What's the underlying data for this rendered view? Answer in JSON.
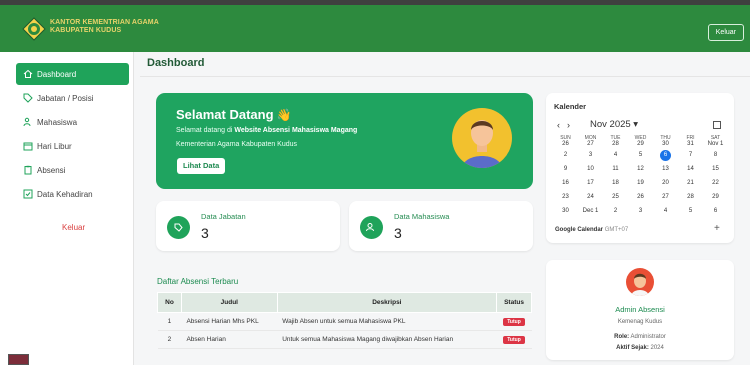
{
  "brand": {
    "line1": "KANTOR KEMENTRIAN AGAMA",
    "line2": "KABUPATEN KUDUS"
  },
  "topbar": {
    "logout_label": "Keluar"
  },
  "sidebar": {
    "items": [
      {
        "label": "Dashboard",
        "icon": "home-icon",
        "active": true
      },
      {
        "label": "Jabatan / Posisi",
        "icon": "tag-icon"
      },
      {
        "label": "Mahasiswa",
        "icon": "users-icon"
      },
      {
        "label": "Hari Libur",
        "icon": "calendar-icon"
      },
      {
        "label": "Absensi",
        "icon": "clipboard-icon"
      },
      {
        "label": "Data Kehadiran",
        "icon": "checkbox-icon"
      }
    ],
    "logout_label": "Keluar"
  },
  "page": {
    "title": "Dashboard"
  },
  "welcome": {
    "title": "Selamat Datang",
    "wave": "👋",
    "text_prefix": "Selamat datang di ",
    "text_bold": "Website Absensi Mahasiswa Magang",
    "text2": "Kementerian Agama Kabupaten Kudus",
    "button_label": "Lihat Data"
  },
  "stats": [
    {
      "label": "Data Jabatan",
      "value": "3",
      "icon": "tag-icon"
    },
    {
      "label": "Data Mahasiswa",
      "value": "3",
      "icon": "users-icon"
    }
  ],
  "calendar": {
    "title": "Kalender",
    "month": "Nov 2025",
    "footer_brand": "Google Calendar",
    "footer_tz": "GMT+07",
    "days": [
      "SUN",
      "MON",
      "TUE",
      "WED",
      "THU",
      "FRI",
      "SAT"
    ],
    "header_dates": [
      "26",
      "27",
      "28",
      "29",
      "30",
      "31",
      "Nov 1"
    ],
    "weeks": [
      [
        "2",
        "3",
        "4",
        "5",
        "6",
        "7",
        "8"
      ],
      [
        "9",
        "10",
        "11",
        "12",
        "13",
        "14",
        "15"
      ],
      [
        "16",
        "17",
        "18",
        "19",
        "20",
        "21",
        "22"
      ],
      [
        "23",
        "24",
        "25",
        "26",
        "27",
        "28",
        "29"
      ],
      [
        "30",
        "Dec 1",
        "2",
        "3",
        "4",
        "5",
        "6"
      ]
    ],
    "today": "6"
  },
  "attendance": {
    "title": "Daftar Absensi Terbaru",
    "headers": [
      "No",
      "Judul",
      "Deskripsi",
      "Status"
    ],
    "rows": [
      {
        "no": "1",
        "judul": "Absensi Harian Mhs PKL",
        "deskripsi": "Wajib Absen untuk semua Mahasiswa PKL",
        "status": "Tutup"
      },
      {
        "no": "2",
        "judul": "Absen Harian",
        "deskripsi": "Untuk semua Mahasiswa Magang diwajibkan Absen Harian",
        "status": "Tutup"
      }
    ]
  },
  "profile": {
    "name": "Admin Absensi",
    "org": "Kemenag Kudus",
    "role_label": "Role:",
    "role_value": "Administrator",
    "since_label": "Aktif Sejak:",
    "since_value": "2024"
  },
  "colors": {
    "primary": "#1fa35a",
    "topbar": "#2d8a3e",
    "danger": "#dc3545",
    "brand_text": "#e7d36a"
  }
}
